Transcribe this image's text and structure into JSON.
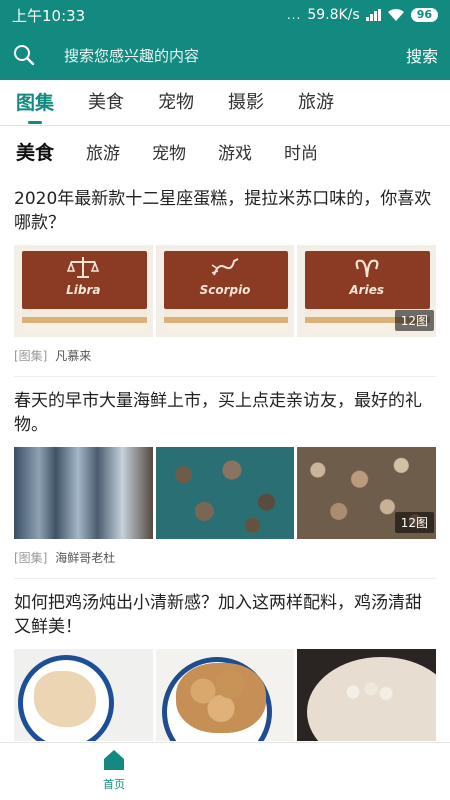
{
  "status_bar": {
    "time": "上午10:33",
    "dots": "...",
    "network_speed": "59.8K/s",
    "battery": "96"
  },
  "search": {
    "placeholder": "搜索您感兴趣的内容",
    "button_label": "搜索"
  },
  "tabs": [
    {
      "label": "图集",
      "active": true
    },
    {
      "label": "美食",
      "active": false
    },
    {
      "label": "宠物",
      "active": false
    },
    {
      "label": "摄影",
      "active": false
    },
    {
      "label": "旅游",
      "active": false
    }
  ],
  "subtags": [
    {
      "label": "美食",
      "active": true
    },
    {
      "label": "旅游",
      "active": false
    },
    {
      "label": "宠物",
      "active": false
    },
    {
      "label": "游戏",
      "active": false
    },
    {
      "label": "时尚",
      "active": false
    }
  ],
  "feed": [
    {
      "title": "2020年最新款十二星座蛋糕，提拉米苏口味的，你喜欢哪款？",
      "image_labels": [
        "Libra",
        "Scorpio",
        "Aries"
      ],
      "image_count": "12图",
      "source": "[图集]",
      "author": "凡慕来"
    },
    {
      "title": "春天的早市大量海鲜上市，买上点走亲访友，最好的礼物。",
      "image_count": "12图",
      "source": "[图集]",
      "author": "海鲜哥老杜"
    },
    {
      "title": "如何把鸡汤炖出小清新感？加入这两样配料，鸡汤清甜又鲜美！"
    }
  ],
  "bottom_nav": {
    "home_label": "首页"
  },
  "colors": {
    "accent": "#128a80"
  }
}
